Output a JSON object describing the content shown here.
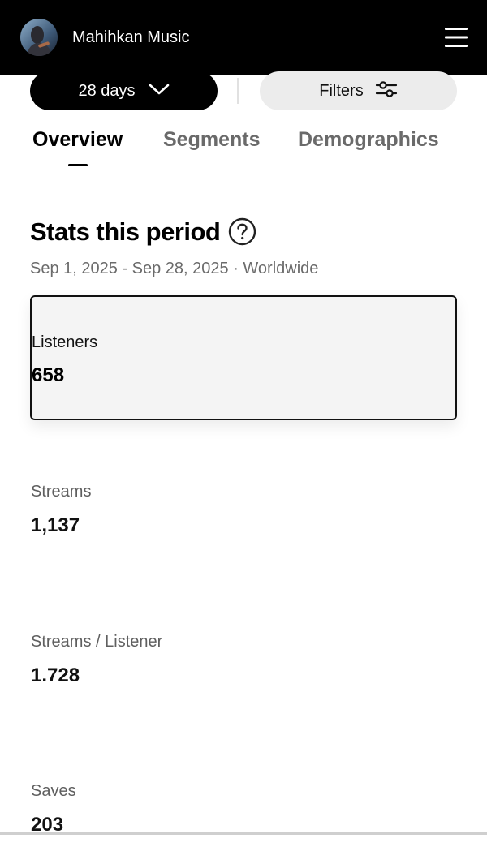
{
  "header": {
    "artist_name": "Mahihkan Music",
    "avatar_icon": "artist-avatar",
    "menu_icon": "hamburger-menu-icon"
  },
  "filters": {
    "range_label": "28 days",
    "range_icon": "chevron-down-icon",
    "filters_label": "Filters",
    "filters_icon": "sliders-icon"
  },
  "tabs": [
    {
      "label": "Overview",
      "active": true
    },
    {
      "label": "Segments",
      "active": false
    },
    {
      "label": "Demographics",
      "active": false
    }
  ],
  "section": {
    "title": "Stats this period",
    "help_icon": "question-circle-icon",
    "period": "Sep 1, 2025 - Sep 28, 2025 · Worldwide"
  },
  "stats": [
    {
      "label": "Listeners",
      "value": "658",
      "selected": true
    },
    {
      "label": "Streams",
      "value": "1,137",
      "selected": false
    },
    {
      "label": "Streams / Listener",
      "value": "1.728",
      "selected": false
    },
    {
      "label": "Saves",
      "value": "203",
      "selected": false
    }
  ],
  "colors": {
    "header_bg": "#000000",
    "selected_card_bg": "#f4f4f4",
    "filters_bg": "#ececec",
    "muted_text": "#6b6b6b"
  }
}
